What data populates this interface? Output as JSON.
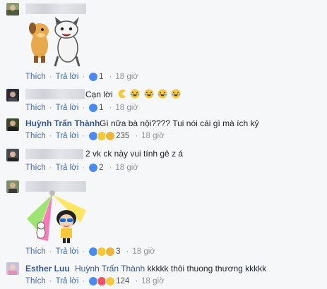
{
  "labels": {
    "like": "Thích",
    "reply": "Trả lời",
    "time_unit": "18 giờ",
    "sep": "·"
  },
  "comments": [
    {
      "author": "",
      "text": "",
      "reactions": 1,
      "time": "18 giờ"
    },
    {
      "author": "",
      "text": "Cạn lời",
      "reactions": 1,
      "time": "18 giờ"
    },
    {
      "author": "Huỳnh Trấn Thành",
      "text": "Gì nữa bà nội???? Tui nói cái gì mà ích kỷ",
      "reactions": 235,
      "time": "18 giờ"
    },
    {
      "author": "",
      "text": "2 vk ck này vui tính gê z á",
      "reactions": 2,
      "time": "18 giờ"
    },
    {
      "author": "",
      "text": "",
      "reactions": 3,
      "time": "18 giờ"
    },
    {
      "author": "Esther Luu",
      "mention": "Huỳnh Trấn Thành",
      "text": "kkkkk thôi thuong thương kkkkk",
      "reactions": 124,
      "time": "18 giờ"
    }
  ],
  "colors": {
    "link": "#4267b2",
    "name": "#365899",
    "meta": "#90949c",
    "like_blue": "#4a8af4",
    "haha_yellow": "#f7c83a"
  }
}
